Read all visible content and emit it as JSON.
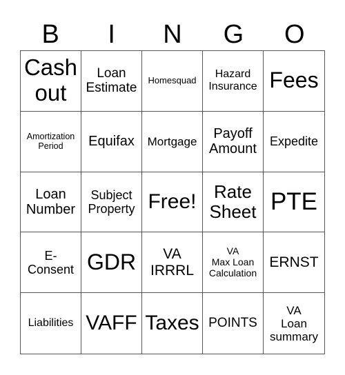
{
  "header": [
    "B",
    "I",
    "N",
    "G",
    "O"
  ],
  "cells": [
    {
      "text": "Cash\nout",
      "size": "s33"
    },
    {
      "text": "Loan\nEstimate",
      "size": "s19"
    },
    {
      "text": "Homesquad",
      "size": "s13"
    },
    {
      "text": "Hazard\nInsurance",
      "size": "s16"
    },
    {
      "text": "Fees",
      "size": "s32"
    },
    {
      "text": "Amortization\nPeriod",
      "size": "s12"
    },
    {
      "text": "Equifax",
      "size": "s20"
    },
    {
      "text": "Mortgage",
      "size": "s17"
    },
    {
      "text": "Payoff\nAmount",
      "size": "s20"
    },
    {
      "text": "Expedite",
      "size": "s18"
    },
    {
      "text": "Loan\nNumber",
      "size": "s20"
    },
    {
      "text": "Subject\nProperty",
      "size": "s18"
    },
    {
      "text": "Free!",
      "size": "s30"
    },
    {
      "text": "Rate\nSheet",
      "size": "s26"
    },
    {
      "text": "PTE",
      "size": "s35"
    },
    {
      "text": "E-\nConsent",
      "size": "s18"
    },
    {
      "text": "GDR",
      "size": "s32"
    },
    {
      "text": "VA\nIRRRL",
      "size": "s21"
    },
    {
      "text": "VA\nMax Loan\nCalculation",
      "size": "s14"
    },
    {
      "text": "ERNST",
      "size": "s21"
    },
    {
      "text": "Liabilities",
      "size": "s16"
    },
    {
      "text": "VAFF",
      "size": "s30"
    },
    {
      "text": "Taxes",
      "size": "s30"
    },
    {
      "text": "POINTS",
      "size": "s19"
    },
    {
      "text": "VA\nLoan\nsummary",
      "size": "s17"
    }
  ]
}
